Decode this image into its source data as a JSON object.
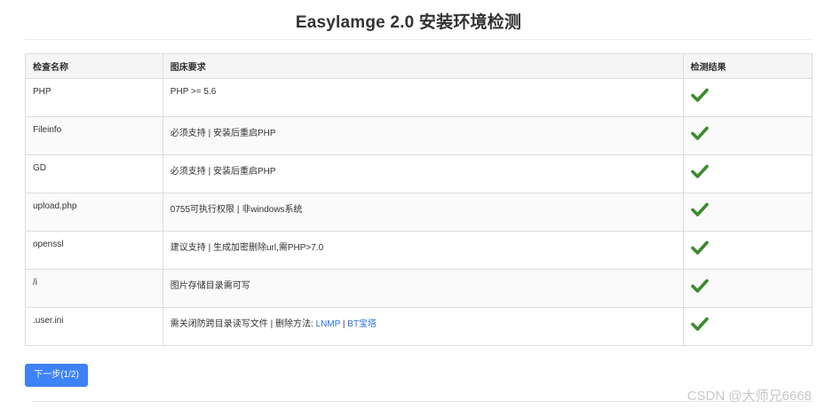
{
  "page": {
    "title": "Easylamge 2.0 安装环境检测"
  },
  "table": {
    "headers": [
      "检查名称",
      "图床要求",
      "检测结果"
    ],
    "rows": [
      {
        "name": "PHP",
        "requirement": "PHP >= 5.6",
        "result": "check-icon"
      },
      {
        "name": "Fileinfo",
        "requirement": "必须支持 | 安装后重启PHP",
        "result": "check-icon"
      },
      {
        "name": "GD",
        "requirement": "必须支持 | 安装后重启PHP",
        "result": "check-icon"
      },
      {
        "name": "upload.php",
        "requirement": "0755可执行权限 | 非windows系统",
        "result": "check-icon"
      },
      {
        "name": "openssl",
        "requirement": "建议支持 | 生成加密删除url,需PHP>7.0",
        "result": "check-icon"
      },
      {
        "name": "/i",
        "requirement": "图片存储目录需可写",
        "result": "check-icon"
      },
      {
        "name": ".user.ini",
        "requirement": "需关闭防跨目录读写文件 | 删除方法: ",
        "result": "check-icon",
        "links": [
          {
            "label": "LNMP"
          },
          {
            "label": "BT宝塔"
          }
        ],
        "link_separator": " | "
      }
    ]
  },
  "actions": {
    "next_label": "下一步(1/2)"
  },
  "watermark": "CSDN @大师兄6668",
  "colors": {
    "check": "#3c8a2e",
    "link": "#2a6fdb",
    "button": "#3e82f7"
  }
}
